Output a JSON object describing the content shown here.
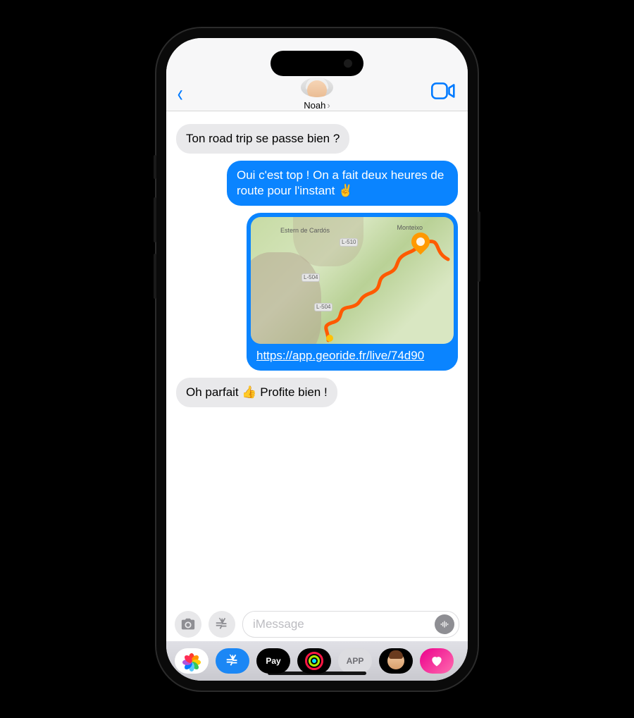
{
  "header": {
    "contact_name": "Noah"
  },
  "messages": [
    {
      "dir": "in",
      "type": "text",
      "text": "Ton road trip se passe bien ?"
    },
    {
      "dir": "out",
      "type": "text",
      "text": "Oui c'est top ! On a fait deux heures de route pour l'instant ✌️"
    },
    {
      "dir": "out",
      "type": "link_preview",
      "url": "https://app.georide.fr/live/74d90",
      "map_labels": {
        "p1": "Estern de Cardós",
        "p2": "Monteixo",
        "r1": "L-510",
        "r2": "L-504",
        "r3": "L-504"
      }
    },
    {
      "dir": "in",
      "type": "text",
      "text": "Oh parfait 👍 Profite bien !"
    }
  ],
  "composer": {
    "placeholder": "iMessage"
  },
  "drawer": {
    "pay_label": "Pay",
    "generic_label": "APP"
  }
}
